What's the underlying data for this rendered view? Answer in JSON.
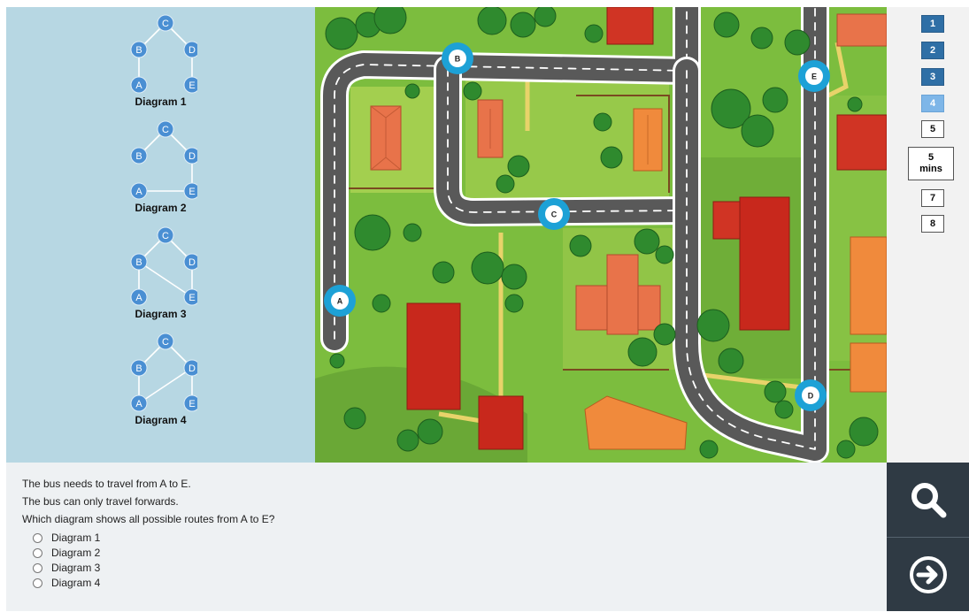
{
  "diagrams": [
    {
      "caption": "Diagram 1",
      "edges": [
        [
          "C",
          "B"
        ],
        [
          "C",
          "D"
        ],
        [
          "B",
          "A"
        ],
        [
          "D",
          "E"
        ]
      ]
    },
    {
      "caption": "Diagram 2",
      "edges": [
        [
          "C",
          "B"
        ],
        [
          "C",
          "D"
        ],
        [
          "A",
          "E"
        ],
        [
          "D",
          "E"
        ]
      ]
    },
    {
      "caption": "Diagram 3",
      "edges": [
        [
          "C",
          "B"
        ],
        [
          "C",
          "D"
        ],
        [
          "B",
          "A"
        ],
        [
          "B",
          "E"
        ],
        [
          "D",
          "E"
        ]
      ]
    },
    {
      "caption": "Diagram 4",
      "edges": [
        [
          "C",
          "B"
        ],
        [
          "C",
          "D"
        ],
        [
          "B",
          "A"
        ],
        [
          "A",
          "D"
        ],
        [
          "D",
          "E"
        ]
      ]
    }
  ],
  "map": {
    "stops": [
      "A",
      "B",
      "C",
      "D",
      "E"
    ]
  },
  "nav": {
    "questions": [
      {
        "label": "1",
        "state": "done"
      },
      {
        "label": "2",
        "state": "done"
      },
      {
        "label": "3",
        "state": "done"
      },
      {
        "label": "4",
        "state": "current"
      },
      {
        "label": "5",
        "state": "todo"
      },
      {
        "label": "7",
        "state": "todo"
      },
      {
        "label": "8",
        "state": "todo"
      }
    ],
    "timer_value": "5",
    "timer_unit": "mins"
  },
  "question": {
    "lines": [
      "The bus needs to travel from A to E.",
      "The bus can only travel forwards.",
      "Which diagram shows all possible routes from A to E?"
    ],
    "options": [
      "Diagram 1",
      "Diagram 2",
      "Diagram 3",
      "Diagram 4"
    ]
  },
  "tools": {
    "zoom_icon": "magnifier-icon",
    "next_icon": "arrow-right-circle-icon"
  },
  "colors": {
    "node_blue": "#4a8fd3",
    "stop_marker": "#1da1d6",
    "nav_done": "#2f6fa6",
    "nav_current": "#7eb6e8",
    "tools_bg": "#2f3a44"
  }
}
